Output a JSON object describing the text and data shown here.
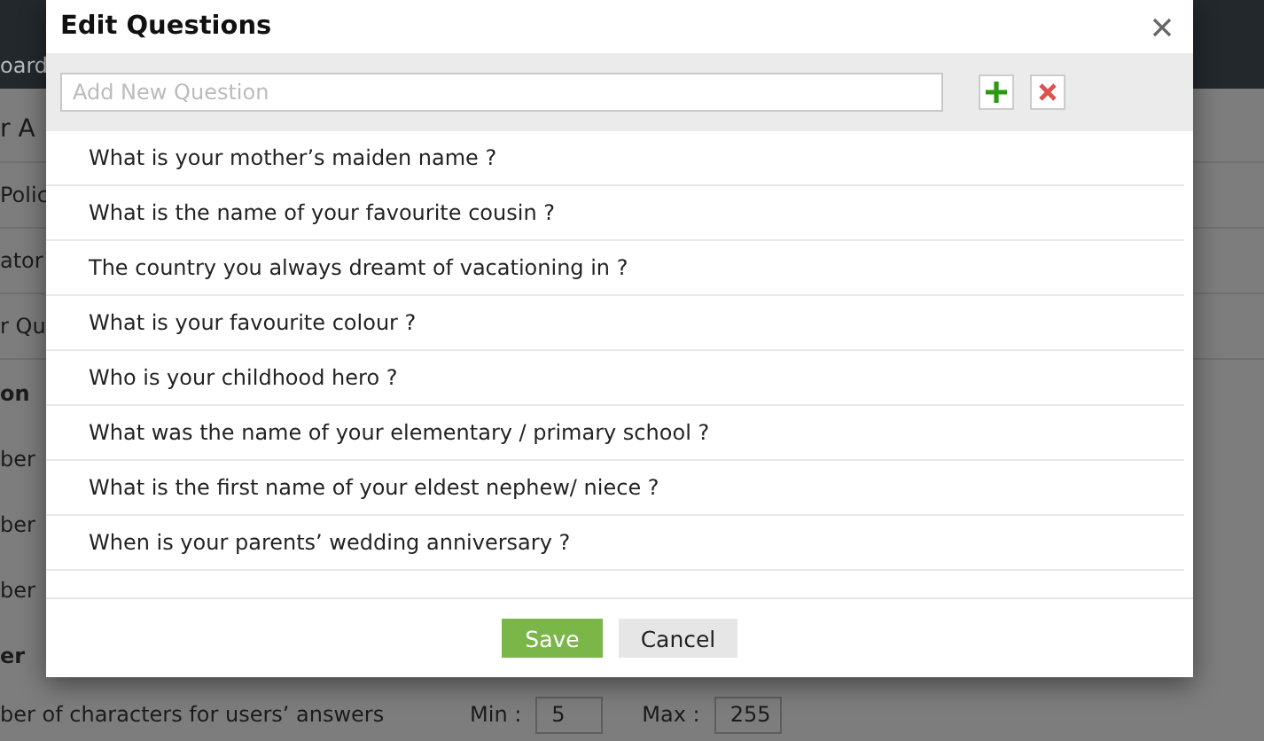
{
  "background": {
    "nav_fragment": "oard",
    "side_fragments": [
      {
        "text": "r A",
        "kind": "title"
      },
      {
        "text": "Polic",
        "kind": "link"
      },
      {
        "text": "ator",
        "kind": "link"
      },
      {
        "text": "r Qu",
        "kind": "link"
      },
      {
        "text": "on",
        "kind": "section"
      },
      {
        "text": "ber",
        "kind": "label"
      },
      {
        "text": "ber",
        "kind": "label"
      },
      {
        "text": "ber",
        "kind": "label"
      },
      {
        "text": "er",
        "kind": "section"
      }
    ],
    "answer_length": {
      "label": "ber of characters for users’ answers",
      "min_label": "Min :",
      "min_value": "5",
      "max_label": "Max :",
      "max_value": "255"
    }
  },
  "dialog": {
    "title": "Edit Questions",
    "new_question": {
      "placeholder": "Add New Question"
    },
    "questions": [
      "What is your mother’s maiden name ?",
      "What is the name of your favourite cousin ?",
      "The country you always dreamt of vacationing in ?",
      "What is your favourite colour ?",
      "Who is your childhood hero ?",
      "What was the name of your elementary / primary school ?",
      "What is the first name of your eldest nephew/ niece ?",
      "When is your parents’ wedding anniversary ?"
    ],
    "buttons": {
      "save": "Save",
      "cancel": "Cancel"
    }
  }
}
